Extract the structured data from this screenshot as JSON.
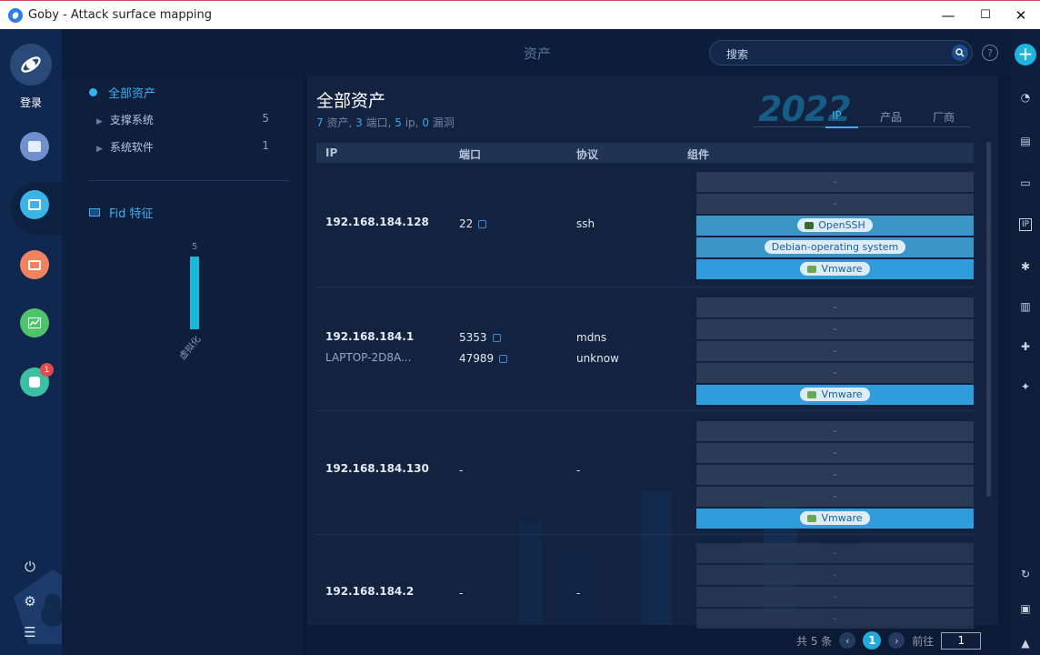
{
  "window": {
    "title": "Goby - Attack surface mapping",
    "min": "—",
    "max": "☐",
    "close": "✕"
  },
  "rail": {
    "login": "登录",
    "badge_count": "1"
  },
  "header": {
    "title": "资产",
    "search_placeholder": "搜索",
    "help": "?"
  },
  "filter": {
    "all_label": "全部资产",
    "groups": [
      {
        "label": "支撑系统",
        "count": "5"
      },
      {
        "label": "系统软件",
        "count": "1"
      }
    ],
    "fid_label": "Fid 特征",
    "fid_bar_value": "5",
    "fid_bar_label": "虚拟化"
  },
  "main": {
    "heading": "全部资产",
    "stats": {
      "assets_num": "7",
      "assets_label": "资产,",
      "ports_num": "3",
      "ports_label": "端口,",
      "ips_num": "5",
      "ips_label": "ip,",
      "vulns_num": "0",
      "vulns_label": "漏洞"
    },
    "year_badge": "2022",
    "tabs": [
      "IP",
      "产品",
      "厂商"
    ],
    "columns": [
      "IP",
      "端口",
      "协议",
      "组件"
    ],
    "rows": [
      {
        "ip": "192.168.184.128",
        "host": "",
        "ports": [
          "22"
        ],
        "protos": [
          "ssh"
        ],
        "components": [
          "-",
          "-",
          "OpenSSH",
          "Debian-operating system",
          "Vmware"
        ]
      },
      {
        "ip": "192.168.184.1",
        "host": "LAPTOP-2D8A...",
        "ports": [
          "5353",
          "47989"
        ],
        "protos": [
          "mdns",
          "unknow"
        ],
        "components": [
          "-",
          "-",
          "-",
          "-",
          "Vmware"
        ]
      },
      {
        "ip": "192.168.184.130",
        "host": "",
        "ports": [
          "-"
        ],
        "protos": [
          "-"
        ],
        "components": [
          "-",
          "-",
          "-",
          "-",
          "Vmware"
        ]
      },
      {
        "ip": "192.168.184.2",
        "host": "",
        "ports": [
          "-"
        ],
        "protos": [
          "-"
        ],
        "components": [
          "-",
          "-",
          "-",
          "-"
        ]
      }
    ]
  },
  "pager": {
    "total": "共 5 条",
    "current": "1",
    "goto_label": "前往",
    "goto_value": "1"
  },
  "colors": {
    "accent": "#21b3df",
    "link": "#37b2ee",
    "component_highlight": "#2f9ddb"
  }
}
